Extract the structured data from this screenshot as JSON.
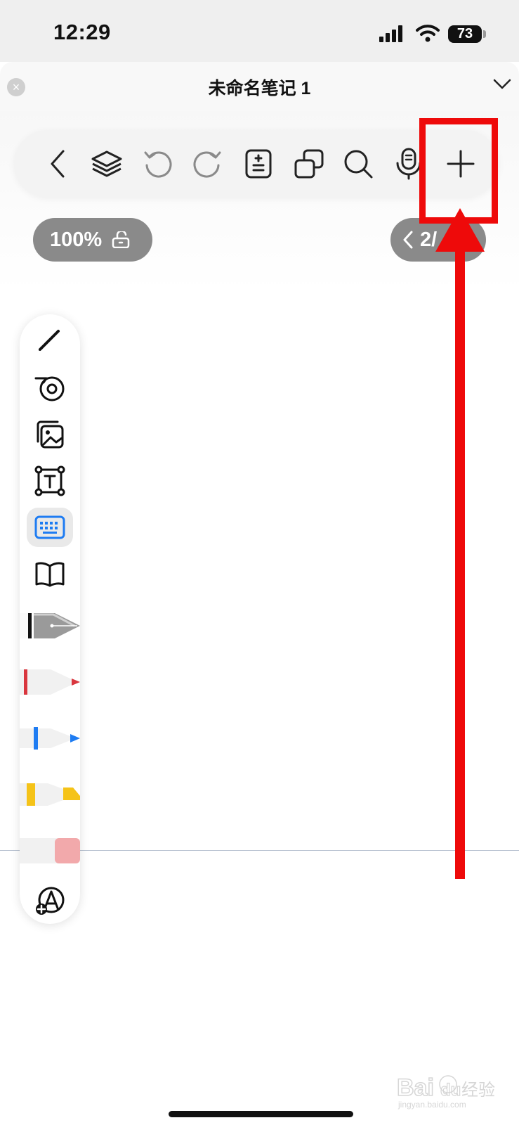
{
  "status_bar": {
    "time": "12:29",
    "battery": "73"
  },
  "note": {
    "title": "未命名笔记 1"
  },
  "toolbar": {
    "items": [
      "back-icon",
      "layers-icon",
      "undo-icon",
      "redo-icon",
      "page-settings-icon",
      "duplicate-icon",
      "search-icon",
      "microphone-icon",
      "add-icon"
    ]
  },
  "zoom": {
    "label": "100%"
  },
  "page_indicator": {
    "label": "2/"
  },
  "side_tools": [
    "pencil-icon",
    "tape-icon",
    "image-icon",
    "text-box-icon",
    "keyboard-icon",
    "book-icon",
    "fountain-pen",
    "red-pen",
    "blue-pen",
    "yellow-highlighter",
    "eraser",
    "add-tool-icon"
  ],
  "annotation": {
    "highlight_color": "#ee0a0a"
  },
  "watermark": {
    "text": "Baidu经验",
    "subtext": "jingyan.baidu.com"
  },
  "colors": {
    "accent": "#1e7cf2",
    "pill": "#8a8a8a"
  }
}
